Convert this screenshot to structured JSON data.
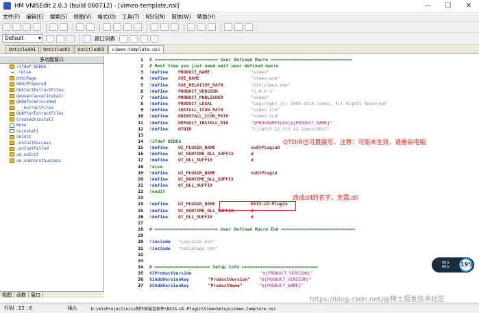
{
  "window": {
    "title": "HM VNISEdit 2.0.3 (build 060712) - [vimeo-template.nsi]",
    "minimize": "—",
    "maximize": "☐",
    "close": "✕"
  },
  "menu": [
    "文件(F)",
    "编辑(E)",
    "搜索(S)",
    "视图(V)",
    "格式(O)",
    "工具(T)",
    "NSIS(N)",
    "窗体(W)",
    "帮助(H)"
  ],
  "toolbar2": {
    "combo_value": "Default",
    "window_list_label": "窗口列表"
  },
  "tabs": [
    "Untitled01",
    "Untitled02",
    "Untitled03",
    "vimeo-template.nsi"
  ],
  "left_panel": {
    "header": "多功能窗口",
    "items": [
      {
        "label": "!ifdef DEBUG",
        "icon": "function-icon"
      },
      {
        "label": "!else",
        "icon": "arrow-icon"
      },
      {
        "label": "QtUiPage",
        "icon": "function-icon"
      },
      {
        "label": "OnUiPrepared",
        "icon": "function-icon"
      },
      {
        "label": "OnStartExtractFiles",
        "icon": "function-icon"
      },
      {
        "label": "OnUserCancelInstall",
        "icon": "function-icon"
      },
      {
        "label": "OnBeforeFinished",
        "icon": "function-icon"
      },
      {
        "label": "___ExtractFiles",
        "icon": "function-icon"
      },
      {
        "label": "OnAfterExtractFiles",
        "icon": "function-icon"
      },
      {
        "label": "CreateUninstall",
        "icon": "function-icon"
      },
      {
        "label": "None",
        "icon": "check-icon"
      },
      {
        "label": "Uninstall",
        "icon": "check-icon"
      },
      {
        "label": "onInit",
        "icon": "function-icon"
      },
      {
        "label": ".onInstSuccess",
        "icon": "function-icon"
      },
      {
        "label": ".onInstFailed",
        "icon": "function-icon"
      },
      {
        "label": "un.onInit",
        "icon": "function-icon"
      },
      {
        "label": "un.onUninstSuccess",
        "icon": "function-icon"
      }
    ],
    "bottom_tabs": [
      "视图",
      "函数",
      "窗口"
    ]
  },
  "code_lines": [
    {
      "n": "1",
      "cls": "c-cmt",
      "text": "# ======================== User Defined Macro ==============================="
    },
    {
      "n": "2",
      "cls": "c-cmt",
      "text": "# Most time you just need edit user defined macro"
    },
    {
      "n": "3",
      "kw": "!define",
      "id": "PRODUCT_NAME",
      "val": "\"vimeo\"",
      "vcls": "c-str"
    },
    {
      "n": "4",
      "kw": "!define",
      "id": "EXE_NAME",
      "val": "\"vimeo.exe\"",
      "vcls": "c-str"
    },
    {
      "n": "5",
      "kw": "!define",
      "id": "EXE_RELATIVE_PATH",
      "val": "\"bin\\vimeo.exe\"",
      "vcls": "c-str"
    },
    {
      "n": "6",
      "kw": "!define",
      "id": "PRODUCT_VERSION",
      "val": "\"1.0.0.1\"",
      "vcls": "c-str"
    },
    {
      "n": "7",
      "kw": "!define",
      "id": "PRODUCT_PUBLISHER",
      "val": "\"vimeo\"",
      "vcls": "c-str"
    },
    {
      "n": "8",
      "kw": "!define",
      "id": "PRODUCT_LEGAL",
      "val": "\"Copyright (c) 1999-2014 vimeo, All Rights Reserved\"",
      "vcls": "c-str"
    },
    {
      "n": "9",
      "kw": "!define",
      "id": "INSTALL_ICON_PATH",
      "val": "\"vimeo.ico\"",
      "vcls": "c-str"
    },
    {
      "n": "10",
      "kw": "!define",
      "id": "UNINSTALL_ICON_PATH",
      "val": "\"vimeo.ico\"",
      "vcls": "c-str"
    },
    {
      "n": "11",
      "kw": "!define",
      "id": "DEFAULT_INSTALL_DIR",
      "val": "\"$PROGRAMFILES\\${PRODUCT_NAME}\"",
      "vcls": "c-var"
    },
    {
      "n": "12",
      "kw": "!define",
      "id": "QTDIR",
      "val": "\"C:\\Qt\\5.12.1\\5.12.1\\msvc2017\"",
      "vcls": "c-str"
    },
    {
      "n": "13",
      "text": ""
    },
    {
      "n": "14",
      "cls": "c-pre",
      "text": "!ifdef DEBUG"
    },
    {
      "n": "15",
      "kw": "!define",
      "id": "UI_PLUGIN_NAME",
      "val": "nsQtPluginD",
      "vcls": "c-id"
    },
    {
      "n": "16",
      "kw": "!define",
      "id": "UC_RUNTIME_DLL_SUFFIX",
      "val": "d",
      "vcls": "c-id"
    },
    {
      "n": "17",
      "kw": "!define",
      "id": "QT_DLL_SUFFIX",
      "val": "d",
      "vcls": "c-id"
    },
    {
      "n": "18",
      "cls": "c-pre",
      "text": "!else"
    },
    {
      "n": "19",
      "kw": "!define",
      "id": "UI_PLUGIN_NAME",
      "val": "nsQtPlugin",
      "vcls": "c-id"
    },
    {
      "n": "20",
      "kw": "!define",
      "id": "UC_RUNTIME_DLL_SUFFIX",
      "val": "",
      "vcls": "c-id"
    },
    {
      "n": "21",
      "kw": "!define",
      "id": "QT_DLL_SUFFIX",
      "val": "",
      "vcls": "c-id"
    },
    {
      "n": "22",
      "cls": "c-pre",
      "text": "!endif"
    },
    {
      "n": "23",
      "text": ""
    },
    {
      "n": "24",
      "kw": "!define",
      "id": "UI_PLUGIN_NAME",
      "val": "NSIS-UI-Plugin",
      "vcls": "c-id"
    },
    {
      "n": "25",
      "kw": "!define",
      "id": "UC_RUNTIME_DLL_SUFFIX",
      "val": "d",
      "vcls": "c-id"
    },
    {
      "n": "26",
      "kw": "!define",
      "id": "QT_DLL_SUFFIX",
      "val": "d",
      "vcls": "c-id"
    },
    {
      "n": "27",
      "text": ""
    },
    {
      "n": "28",
      "cls": "c-cmt",
      "text": "# ======================== User Defined Macro End ============================"
    },
    {
      "n": "29",
      "text": ""
    },
    {
      "n": "30",
      "kw": "!include",
      "id": "",
      "val": "\"LogicLib.nsh\"",
      "vcls": "c-str"
    },
    {
      "n": "31",
      "kw": "!include",
      "id": "",
      "val": "\"nsDialogs.nsh\"",
      "vcls": "c-str"
    },
    {
      "n": "32",
      "text": ""
    },
    {
      "n": "33",
      "text": ""
    },
    {
      "n": "34",
      "cls": "c-cmt",
      "text": "# ===================== Setup Info ============================="
    },
    {
      "n": "35",
      "kw": "VIProductVersion",
      "id": "",
      "val": "\"${PRODUCT_VERSION}\"",
      "vcls": "c-var"
    },
    {
      "n": "36",
      "kw": "VIAddVersionKey",
      "id": "\"ProductVersion\"",
      "val": "\"${PRODUCT_VERSION}\"",
      "vcls": "c-var"
    },
    {
      "n": "37",
      "kw": "VIAddVersionKey",
      "id": "\"ProductName\"",
      "val": "\"${PRODUCT_NAME}\"",
      "vcls": "c-var"
    }
  ],
  "annotations": {
    "qtdir_note": "QTDIR也可直接写，注意：可能未生效，请重启电脑",
    "dll_note": "改成dll的名字，无需.dll"
  },
  "status": {
    "position": "行列 : 22 : 6",
    "mode": "插入",
    "path": "D:\\misProject\\nsis制作安装包软件\\NSIS-UI-Plugin\\VimeoSetup\\vimeo-template.nsi"
  },
  "badge": {
    "percent": "19%",
    "up": "0K/s",
    "down": "0K/s"
  },
  "watermark": "https://blog.csdn.net/@稀土掘金技术社区",
  "colors": {
    "comment": "#1a7a1a",
    "keyword": "#1a3cb0",
    "identifier": "#8a1a1a",
    "string": "#888888",
    "variable": "#b01a8a",
    "annotation": "#e8201a"
  }
}
